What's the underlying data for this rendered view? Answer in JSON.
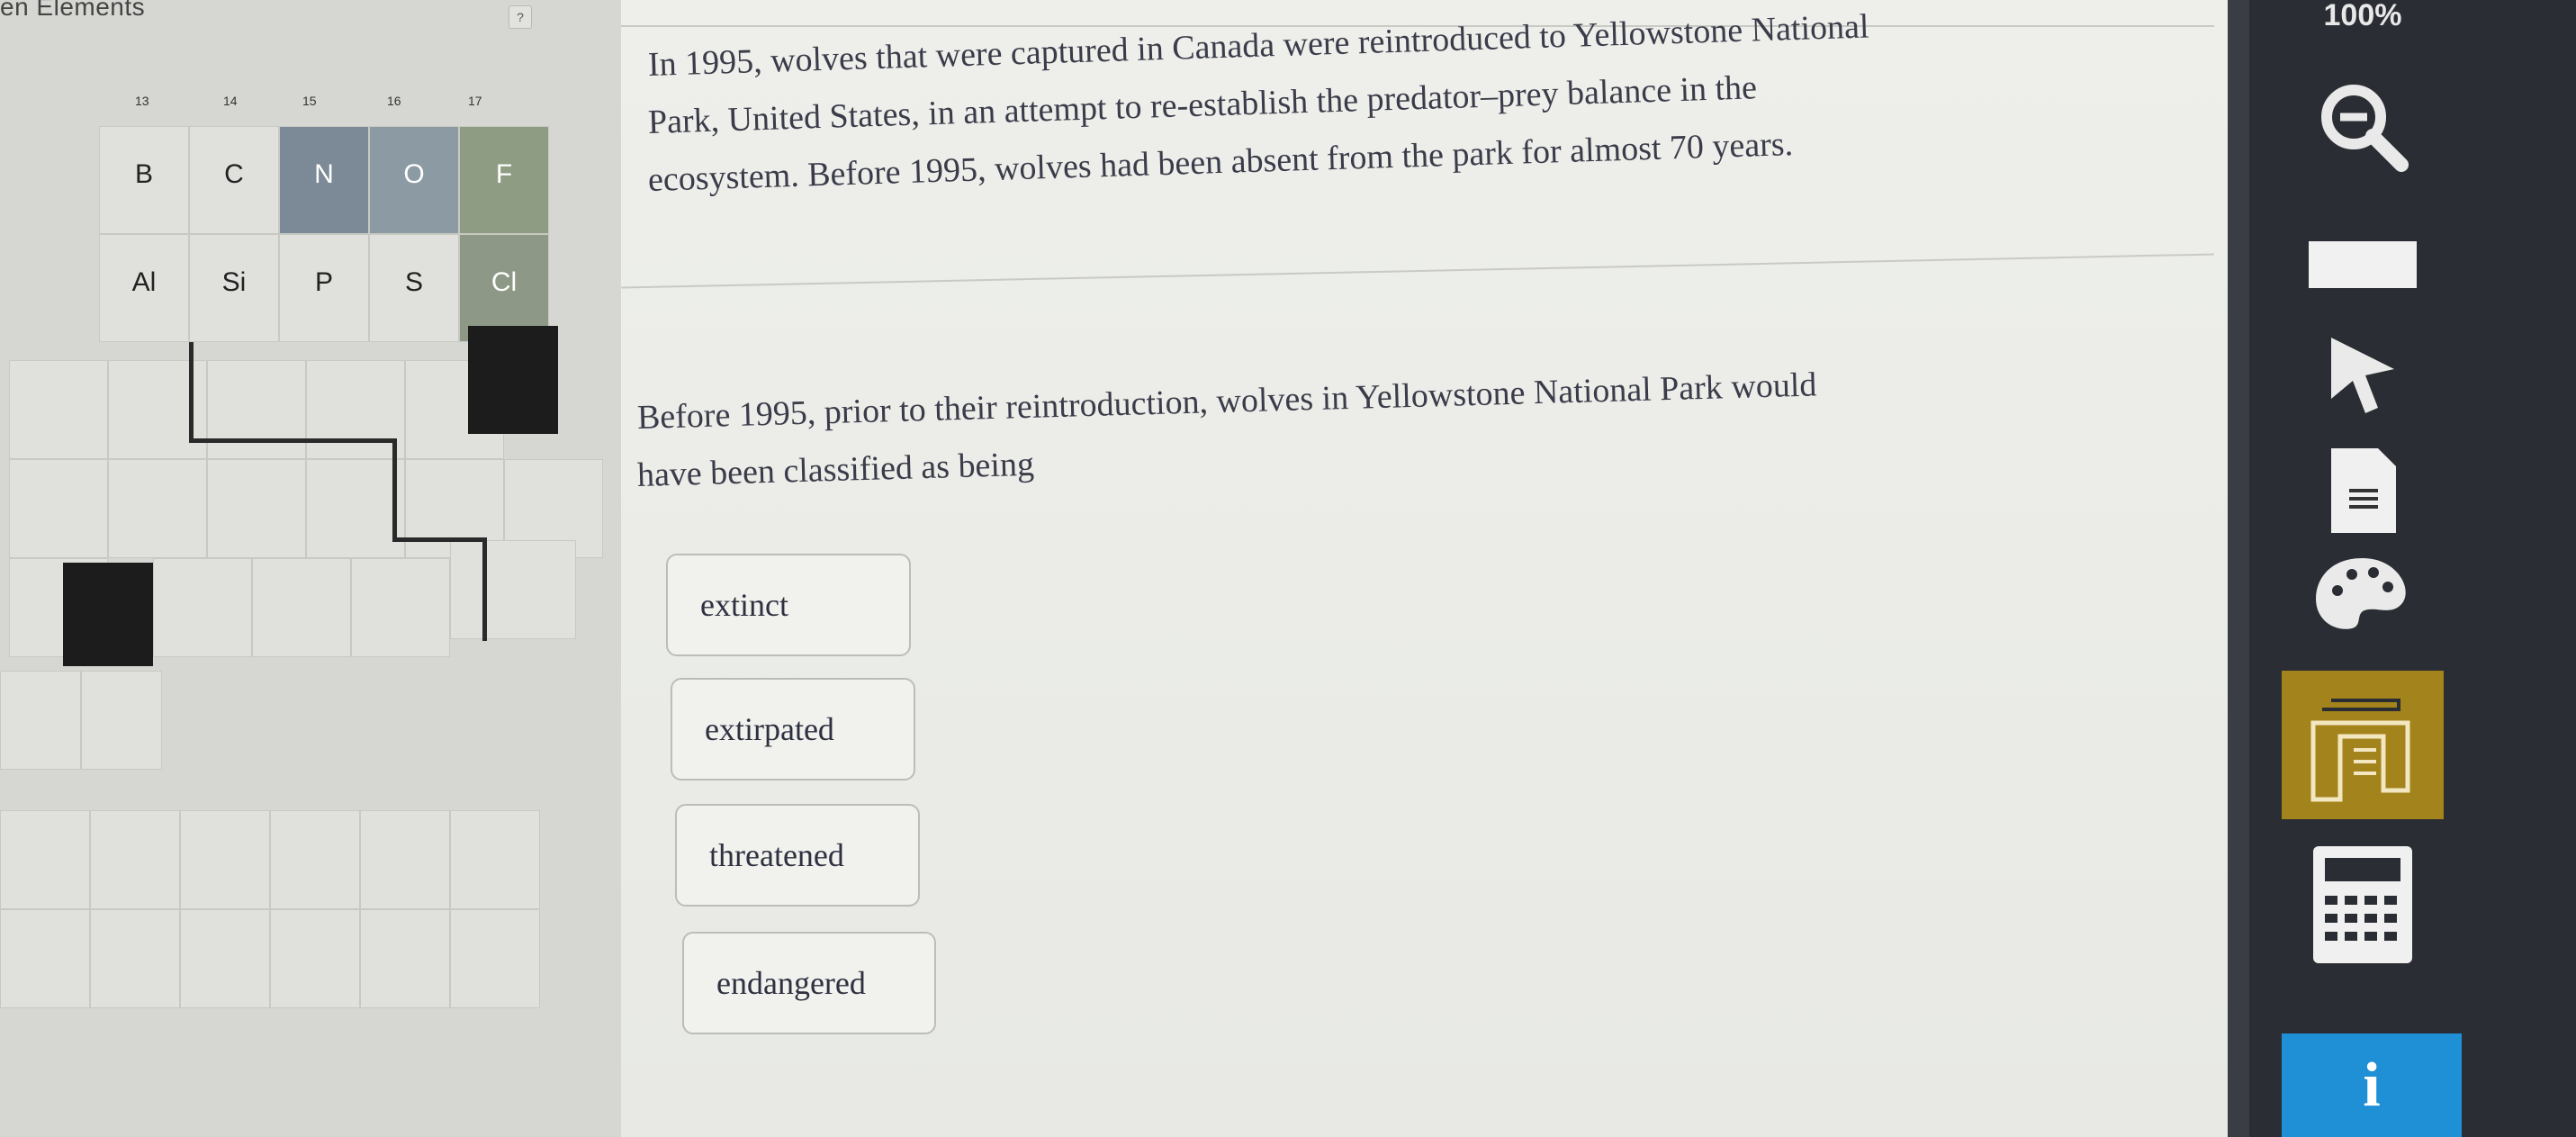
{
  "periodic_table": {
    "title": "en Elements",
    "mini_button": "?",
    "group_numbers": [
      "13",
      "14",
      "15",
      "16",
      "17"
    ],
    "elements_row2": [
      "B",
      "C",
      "N",
      "O",
      "F"
    ],
    "elements_row3": [
      "Al",
      "Si",
      "P",
      "S",
      "Cl"
    ]
  },
  "question": {
    "passage_lines": [
      "In 1995, wolves that were captured in Canada were reintroduced to Yellowstone National",
      "Park, United States, in an attempt to re-establish the predator–prey balance in the",
      "ecosystem. Before 1995, wolves had been absent from the park for almost 70 years."
    ],
    "prompt_lines": [
      "Before 1995, prior to their reintroduction, wolves in Yellowstone National Park would",
      "have been classified as being"
    ],
    "answers": [
      "extinct",
      "extirpated",
      "threatened",
      "endangered"
    ]
  },
  "toolbar": {
    "zoom": "100%"
  }
}
